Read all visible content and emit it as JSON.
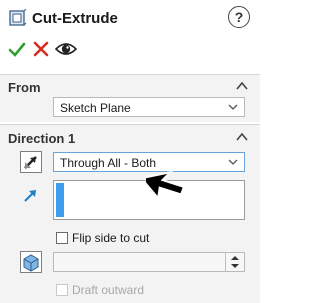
{
  "header": {
    "title": "Cut-Extrude",
    "help_glyph": "?",
    "icons": [
      "cut-extrude-icon",
      "ok-icon",
      "cancel-icon",
      "preview-eye-icon",
      "help-icon"
    ]
  },
  "from": {
    "label": "From",
    "value": "Sketch Plane"
  },
  "direction1": {
    "label": "Direction 1",
    "end_condition": "Through All - Both",
    "flip_side_label": "Flip side to cut",
    "draft_label": "Draft outward",
    "draft_value": ""
  },
  "colors": {
    "accent_blue": "#3c9cf0",
    "ok_green": "#2f9e2f",
    "cancel_red": "#d62d20"
  }
}
